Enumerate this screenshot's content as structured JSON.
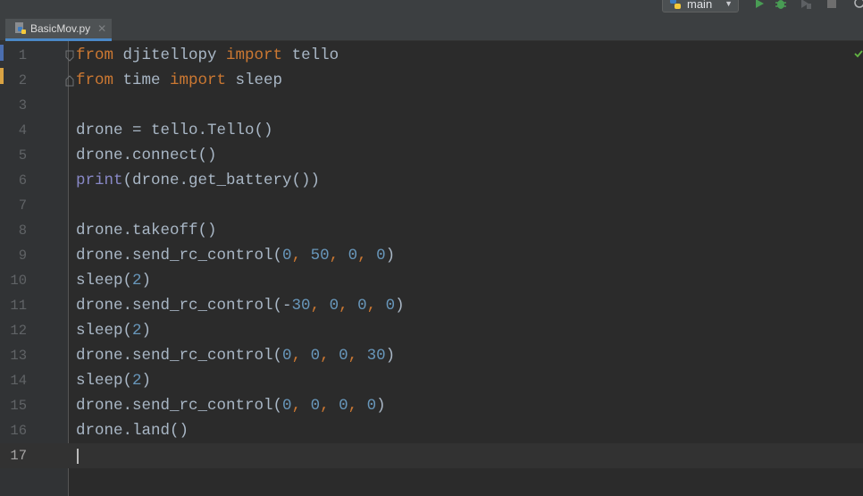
{
  "toolbar": {
    "run_config": "main",
    "icons": [
      "python-icon",
      "chevron-down-icon",
      "run-icon",
      "debug-icon",
      "coverage-icon",
      "stop-icon",
      "search-icon"
    ],
    "colors": {
      "run": "#499c54",
      "debug": "#499c54",
      "stop": "#6e6e6e"
    }
  },
  "tabs": [
    {
      "label": "BasicMov.py",
      "active": true,
      "icon": "python-file-icon",
      "close": "✕"
    }
  ],
  "editor": {
    "current_line": 17,
    "lines": [
      {
        "num": "1",
        "tokens": [
          {
            "t": "from",
            "c": "kw"
          },
          {
            "t": " djitellopy ",
            "c": "id"
          },
          {
            "t": "import",
            "c": "kw"
          },
          {
            "t": " tello",
            "c": "id"
          }
        ],
        "fold": true
      },
      {
        "num": "2",
        "tokens": [
          {
            "t": "from",
            "c": "kw"
          },
          {
            "t": " time ",
            "c": "id"
          },
          {
            "t": "import",
            "c": "kw"
          },
          {
            "t": " sleep",
            "c": "id"
          }
        ],
        "fold": true
      },
      {
        "num": "3",
        "tokens": []
      },
      {
        "num": "4",
        "tokens": [
          {
            "t": "drone = tello.Tello()",
            "c": "id"
          }
        ]
      },
      {
        "num": "5",
        "tokens": [
          {
            "t": "drone.connect()",
            "c": "id"
          }
        ]
      },
      {
        "num": "6",
        "tokens": [
          {
            "t": "print",
            "c": "bi"
          },
          {
            "t": "(drone.get_battery())",
            "c": "id"
          }
        ]
      },
      {
        "num": "7",
        "tokens": []
      },
      {
        "num": "8",
        "tokens": [
          {
            "t": "drone.takeoff()",
            "c": "id"
          }
        ]
      },
      {
        "num": "9",
        "tokens": [
          {
            "t": "drone.send_rc_control(",
            "c": "id"
          },
          {
            "t": "0",
            "c": "num"
          },
          {
            "t": ", ",
            "c": "kw"
          },
          {
            "t": "50",
            "c": "num"
          },
          {
            "t": ", ",
            "c": "kw"
          },
          {
            "t": "0",
            "c": "num"
          },
          {
            "t": ", ",
            "c": "kw"
          },
          {
            "t": "0",
            "c": "num"
          },
          {
            "t": ")",
            "c": "id"
          }
        ]
      },
      {
        "num": "10",
        "tokens": [
          {
            "t": "sleep(",
            "c": "id"
          },
          {
            "t": "2",
            "c": "num"
          },
          {
            "t": ")",
            "c": "id"
          }
        ]
      },
      {
        "num": "11",
        "tokens": [
          {
            "t": "drone.send_rc_control(-",
            "c": "id"
          },
          {
            "t": "30",
            "c": "num"
          },
          {
            "t": ", ",
            "c": "kw"
          },
          {
            "t": "0",
            "c": "num"
          },
          {
            "t": ", ",
            "c": "kw"
          },
          {
            "t": "0",
            "c": "num"
          },
          {
            "t": ", ",
            "c": "kw"
          },
          {
            "t": "0",
            "c": "num"
          },
          {
            "t": ")",
            "c": "id"
          }
        ]
      },
      {
        "num": "12",
        "tokens": [
          {
            "t": "sleep(",
            "c": "id"
          },
          {
            "t": "2",
            "c": "num"
          },
          {
            "t": ")",
            "c": "id"
          }
        ]
      },
      {
        "num": "13",
        "tokens": [
          {
            "t": "drone.send_rc_control(",
            "c": "id"
          },
          {
            "t": "0",
            "c": "num"
          },
          {
            "t": ", ",
            "c": "kw"
          },
          {
            "t": "0",
            "c": "num"
          },
          {
            "t": ", ",
            "c": "kw"
          },
          {
            "t": "0",
            "c": "num"
          },
          {
            "t": ", ",
            "c": "kw"
          },
          {
            "t": "30",
            "c": "num"
          },
          {
            "t": ")",
            "c": "id"
          }
        ]
      },
      {
        "num": "14",
        "tokens": [
          {
            "t": "sleep(",
            "c": "id"
          },
          {
            "t": "2",
            "c": "num"
          },
          {
            "t": ")",
            "c": "id"
          }
        ]
      },
      {
        "num": "15",
        "tokens": [
          {
            "t": "drone.send_rc_control(",
            "c": "id"
          },
          {
            "t": "0",
            "c": "num"
          },
          {
            "t": ", ",
            "c": "kw"
          },
          {
            "t": "0",
            "c": "num"
          },
          {
            "t": ", ",
            "c": "kw"
          },
          {
            "t": "0",
            "c": "num"
          },
          {
            "t": ", ",
            "c": "kw"
          },
          {
            "t": "0",
            "c": "num"
          },
          {
            "t": ")",
            "c": "id"
          }
        ]
      },
      {
        "num": "16",
        "tokens": [
          {
            "t": "drone.land()",
            "c": "id"
          }
        ]
      },
      {
        "num": "17",
        "tokens": []
      }
    ],
    "colors": {
      "keyword": "#cc7832",
      "number": "#6897bb",
      "builtin": "#8888c6",
      "identifier": "#a9b7c6",
      "background": "#2b2b2b",
      "gutter": "#313335",
      "inspection_ok": "#62b543"
    }
  }
}
